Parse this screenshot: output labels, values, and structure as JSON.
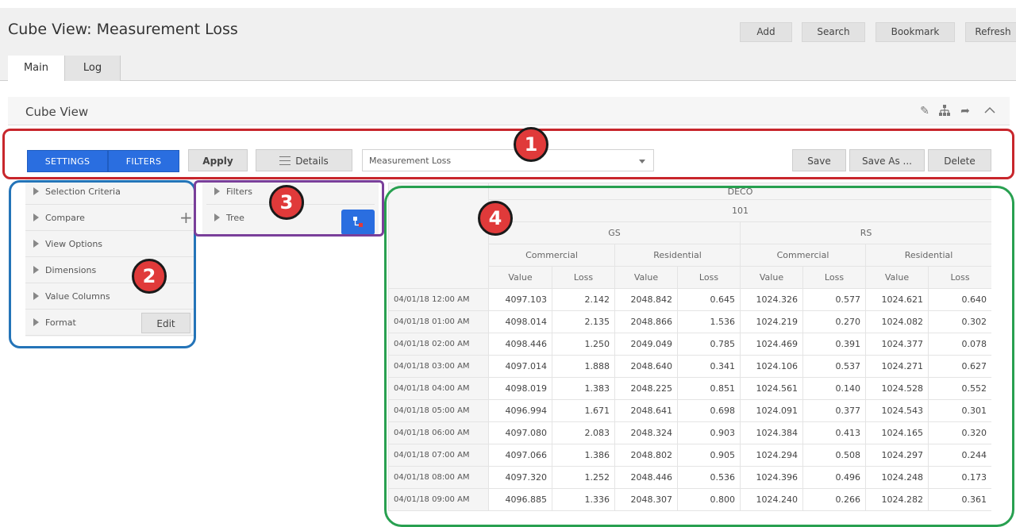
{
  "header": {
    "title": "Cube View: Measurement Loss",
    "buttons": [
      "Add",
      "Search",
      "Bookmark",
      "Refresh"
    ],
    "tabs": [
      "Main",
      "Log"
    ]
  },
  "panel": {
    "title": "Cube View",
    "icons": [
      "edit-icon",
      "hierarchy-icon",
      "share-icon",
      "chevron-up-icon"
    ]
  },
  "toolbar": {
    "settings": "SETTINGS",
    "filters": "FILTERS",
    "apply": "Apply",
    "details": "Details",
    "select_value": "Measurement Loss",
    "save": "Save",
    "save_as": "Save As ...",
    "delete": "Delete"
  },
  "callouts": [
    "1",
    "2",
    "3",
    "4"
  ],
  "left_panel": {
    "items": [
      "Selection Criteria",
      "Compare",
      "View Options",
      "Dimensions",
      "Value Columns",
      "Format"
    ],
    "edit": "Edit"
  },
  "middle_panel": {
    "items": [
      "Filters",
      "Tree"
    ]
  },
  "grid": {
    "h1": "DECO",
    "h2": "101",
    "groups": [
      "GS",
      "RS"
    ],
    "subgroups": [
      "Commercial",
      "Residential",
      "Commercial",
      "Residential"
    ],
    "cols": [
      "Value",
      "Loss",
      "Value",
      "Loss",
      "Value",
      "Loss",
      "Value",
      "Loss"
    ],
    "rows": [
      {
        "label": "04/01/18 12:00 AM",
        "vals": [
          "4097.103",
          "2.142",
          "2048.842",
          "0.645",
          "1024.326",
          "0.577",
          "1024.621",
          "0.640"
        ]
      },
      {
        "label": "04/01/18 01:00 AM",
        "vals": [
          "4098.014",
          "2.135",
          "2048.866",
          "1.536",
          "1024.219",
          "0.270",
          "1024.082",
          "0.302"
        ]
      },
      {
        "label": "04/01/18 02:00 AM",
        "vals": [
          "4098.446",
          "1.250",
          "2049.049",
          "0.785",
          "1024.469",
          "0.391",
          "1024.377",
          "0.078"
        ]
      },
      {
        "label": "04/01/18 03:00 AM",
        "vals": [
          "4097.014",
          "1.888",
          "2048.640",
          "0.341",
          "1024.106",
          "0.537",
          "1024.271",
          "0.627"
        ]
      },
      {
        "label": "04/01/18 04:00 AM",
        "vals": [
          "4098.019",
          "1.383",
          "2048.225",
          "0.851",
          "1024.561",
          "0.140",
          "1024.528",
          "0.552"
        ]
      },
      {
        "label": "04/01/18 05:00 AM",
        "vals": [
          "4096.994",
          "1.671",
          "2048.641",
          "0.698",
          "1024.091",
          "0.377",
          "1024.543",
          "0.301"
        ]
      },
      {
        "label": "04/01/18 06:00 AM",
        "vals": [
          "4097.080",
          "2.083",
          "2048.324",
          "0.903",
          "1024.384",
          "0.413",
          "1024.165",
          "0.320"
        ]
      },
      {
        "label": "04/01/18 07:00 AM",
        "vals": [
          "4097.066",
          "1.386",
          "2048.802",
          "0.905",
          "1024.294",
          "0.508",
          "1024.297",
          "0.244"
        ]
      },
      {
        "label": "04/01/18 08:00 AM",
        "vals": [
          "4097.320",
          "1.252",
          "2048.446",
          "0.536",
          "1024.396",
          "0.496",
          "1024.248",
          "0.173"
        ]
      },
      {
        "label": "04/01/18 09:00 AM",
        "vals": [
          "4096.885",
          "1.336",
          "2048.307",
          "0.800",
          "1024.240",
          "0.266",
          "1024.282",
          "0.361"
        ]
      }
    ]
  },
  "colors": {
    "ring1": "#c8262c",
    "ring2": "#2474b8",
    "ring3": "#7a3f9a",
    "ring4": "#28a050",
    "button_blue": "#2a6ee0"
  }
}
